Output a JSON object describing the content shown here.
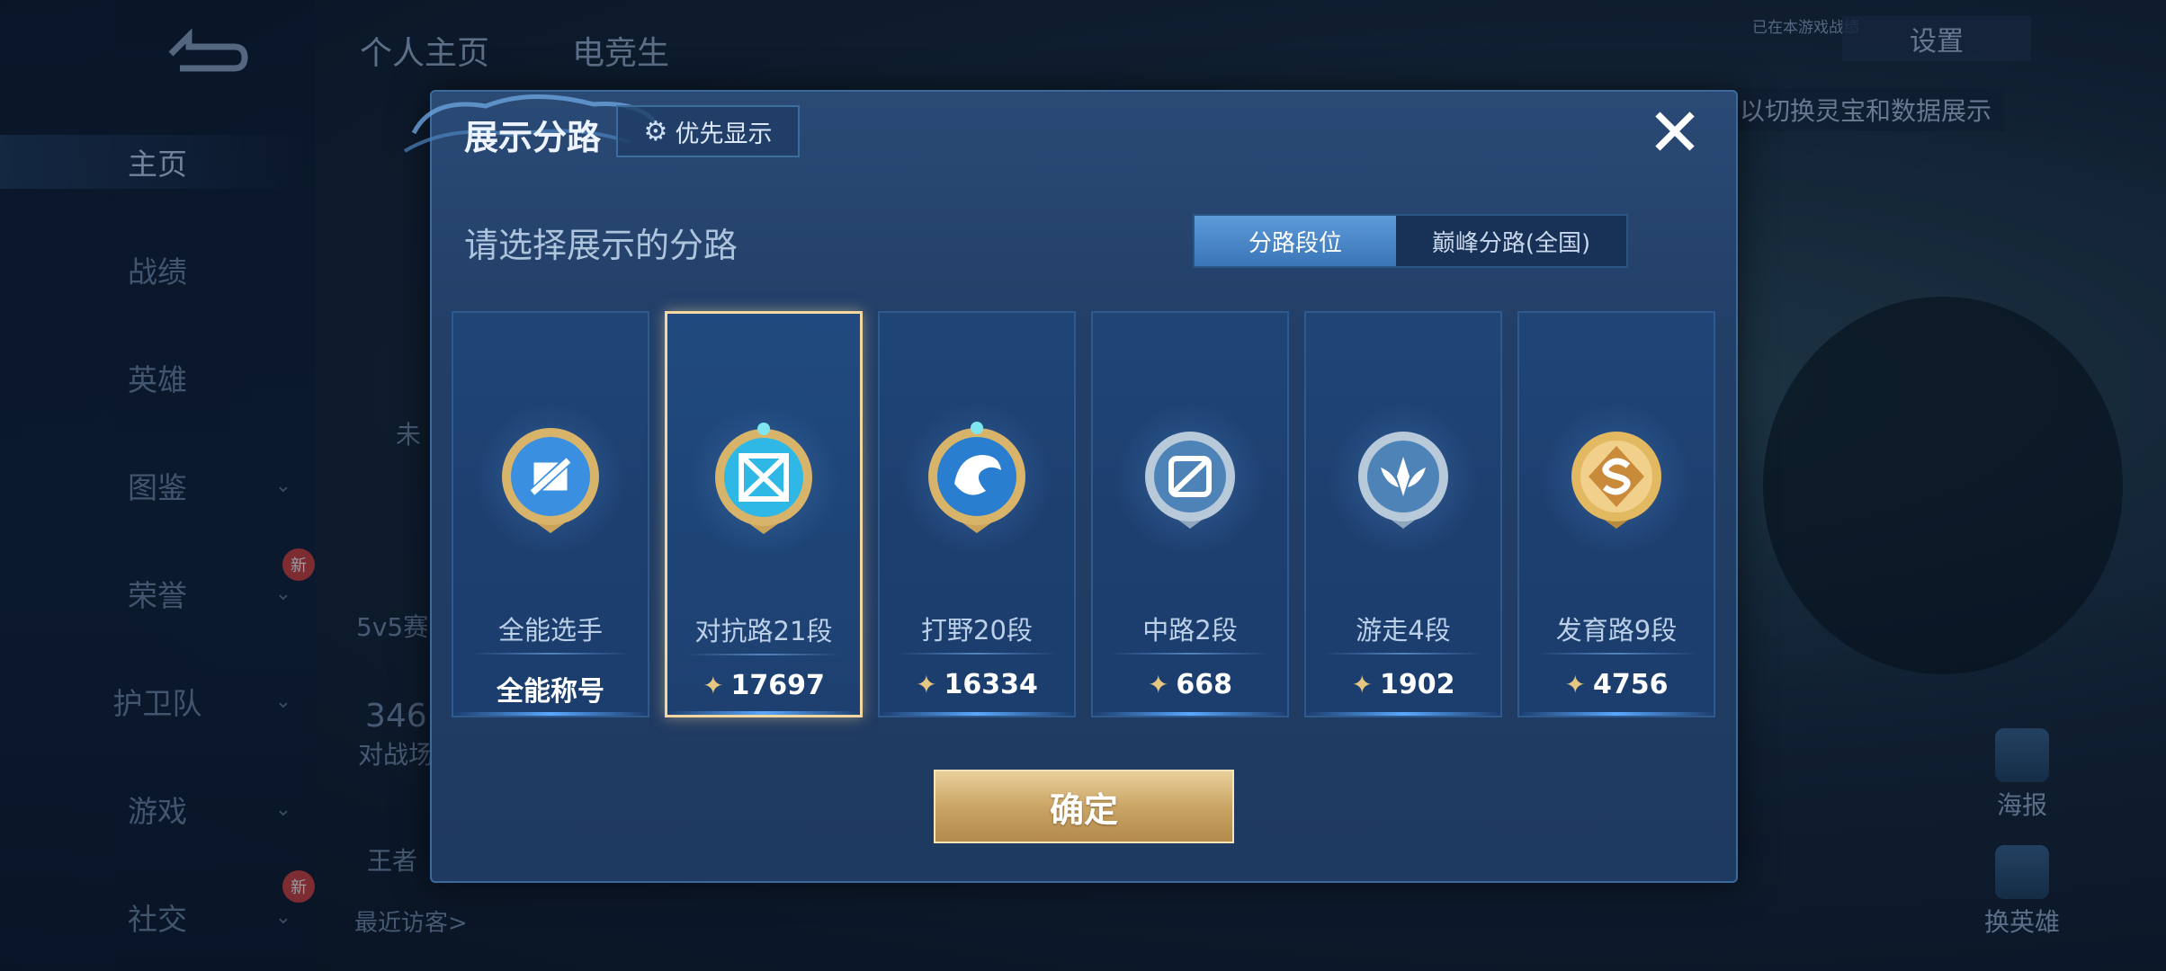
{
  "background": {
    "tabs": [
      "个人主页",
      "电竞生"
    ],
    "settings_label": "设置",
    "hint_text": "以切换灵宝和数据展示",
    "tiny_text": "已在本游戏战绩",
    "sidebar": [
      {
        "label": "主页"
      },
      {
        "label": "战绩"
      },
      {
        "label": "英雄"
      },
      {
        "label": "图鉴"
      },
      {
        "label": "荣誉"
      },
      {
        "label": "护卫队"
      },
      {
        "label": "游戏"
      },
      {
        "label": "社交"
      }
    ],
    "new_badge": "新",
    "profile_snippets": [
      "未",
      "5v5赛",
      "346",
      "对战场",
      "王者",
      "最近访客>"
    ],
    "right_buttons": [
      "海报",
      "换英雄"
    ]
  },
  "modal": {
    "title": "展示分路",
    "priority_button": "优先显示",
    "subtitle": "请选择展示的分路",
    "segments": [
      "分路段位",
      "巅峰分路(全国)"
    ],
    "active_segment": 0,
    "confirm_label": "确定",
    "cards": [
      {
        "name": "全能选手",
        "value": "全能称号",
        "has_points": false,
        "selected": false,
        "icon": "all-round-badge-icon"
      },
      {
        "name": "对抗路21段",
        "value": "17697",
        "has_points": true,
        "selected": true,
        "icon": "clash-lane-badge-icon"
      },
      {
        "name": "打野20段",
        "value": "16334",
        "has_points": true,
        "selected": false,
        "icon": "jungle-badge-icon"
      },
      {
        "name": "中路2段",
        "value": "668",
        "has_points": true,
        "selected": false,
        "icon": "mid-lane-badge-icon"
      },
      {
        "name": "游走4段",
        "value": "1902",
        "has_points": true,
        "selected": false,
        "icon": "roam-badge-icon"
      },
      {
        "name": "发育路9段",
        "value": "4756",
        "has_points": true,
        "selected": false,
        "icon": "farm-lane-badge-icon"
      }
    ]
  },
  "colors": {
    "accent_gold": "#e6c681",
    "selected_border": "#f2d7a0",
    "segment_active": "#4a89cc"
  }
}
